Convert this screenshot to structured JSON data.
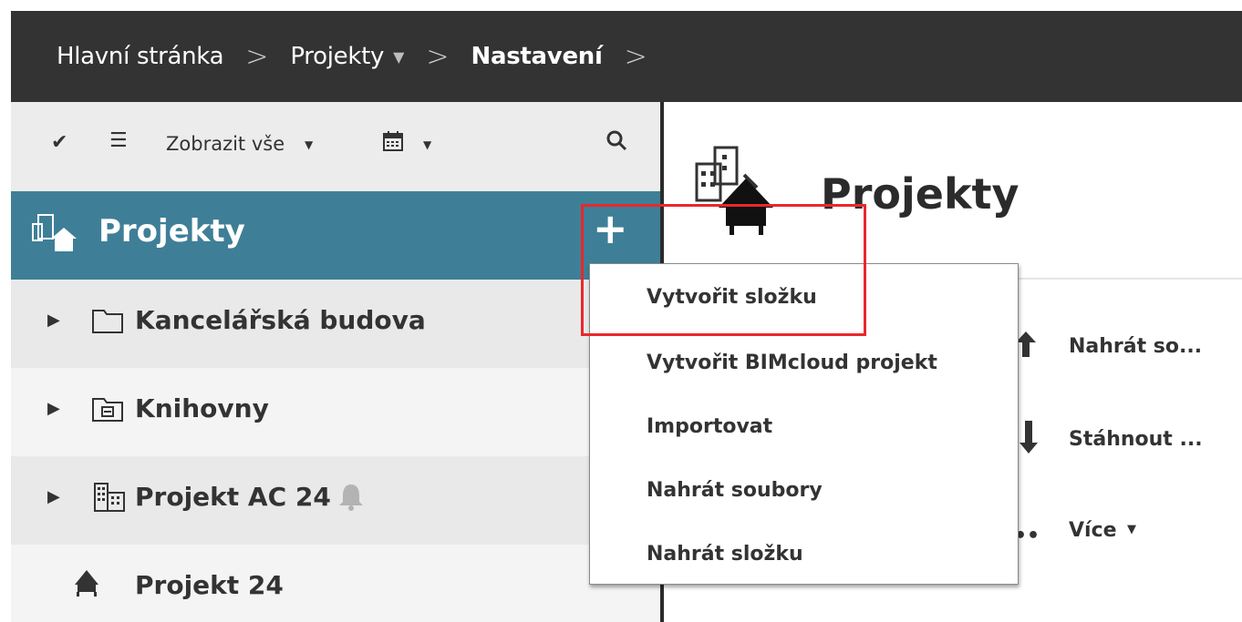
{
  "breadcrumb": {
    "items": [
      "Hlavní stránka",
      "Projekty",
      "Nastavení"
    ],
    "separator": ">"
  },
  "toolbar": {
    "show_all_label": "Zobrazit vše"
  },
  "sidebar": {
    "header_title": "Projekty",
    "add_label": "+",
    "items": [
      {
        "label": "Kancelářská budova",
        "icon": "folder-icon"
      },
      {
        "label": "Knihovny",
        "icon": "library-folder-icon"
      },
      {
        "label": "Projekt AC 24",
        "icon": "building-icon"
      },
      {
        "label": "Projekt 24",
        "icon": "house-icon"
      }
    ]
  },
  "main": {
    "title": "Projekty",
    "actions": [
      "Nahrát so...",
      "Stáhnout ...",
      "Více"
    ]
  },
  "dropdown": {
    "items": [
      "Vytvořit složku",
      "Vytvořit BIMcloud projekt",
      "Importovat",
      "Nahrát soubory",
      "Nahrát složku"
    ]
  },
  "colors": {
    "topbar": "#333333",
    "sidebar_header": "#3e7f97",
    "highlight": "#e8282b"
  }
}
